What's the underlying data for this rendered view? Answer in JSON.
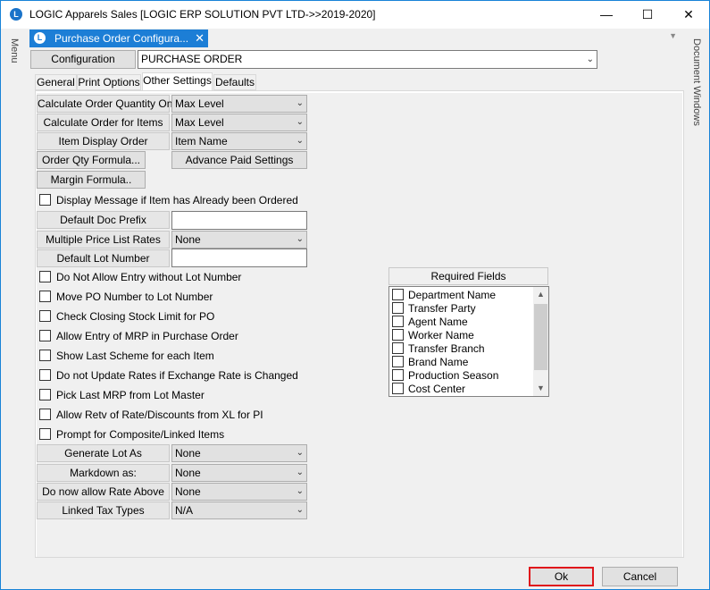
{
  "window": {
    "title": "LOGIC Apparels Sales  [LOGIC ERP SOLUTION PVT LTD->>2019-2020]",
    "icon": "logic-app-icon",
    "controls": {
      "minimize": "—",
      "maximize": "☐",
      "close": "✕"
    }
  },
  "side": {
    "left_label": "Menu",
    "right_label": "Document Windows"
  },
  "doc_tab": {
    "label": "Purchase Order Configura...",
    "close": "✕"
  },
  "configuration": {
    "button_label": "Configuration",
    "value": "PURCHASE ORDER"
  },
  "tabs": [
    "General",
    "Print Options",
    "Other Settings",
    "Defaults"
  ],
  "active_tab": "Other Settings",
  "settings": {
    "calc_qty_label": "Calculate Order Quantity On",
    "calc_qty_value": "Max Level",
    "calc_items_label": "Calculate Order for Items",
    "calc_items_value": "Max Level",
    "item_display_label": "Item Display Order",
    "item_display_value": "Item Name",
    "order_qty_formula": "Order Qty Formula...",
    "advance_paid": "Advance Paid Settings",
    "margin_formula": "Margin Formula..",
    "display_message": "Display Message if Item has Already been Ordered",
    "doc_prefix_label": "Default Doc Prefix",
    "doc_prefix_value": "",
    "price_list_label": "Multiple Price List Rates",
    "price_list_value": "None",
    "lot_number_label": "Default Lot Number",
    "lot_number_value": ""
  },
  "checkboxes": [
    "Do Not Allow Entry without Lot Number",
    "Move PO Number to Lot Number",
    "Check Closing Stock Limit for PO",
    "Allow Entry of MRP in Purchase Order",
    "Show Last Scheme for each Item",
    "Do not Update Rates if Exchange Rate is Changed",
    "Pick Last MRP from Lot Master",
    "Allow Retv of Rate/Discounts from XL for PI",
    "Prompt for Composite/Linked Items"
  ],
  "bottom_settings": [
    {
      "label": "Generate Lot As",
      "value": "None"
    },
    {
      "label": "Markdown as:",
      "value": "None"
    },
    {
      "label": "Do now allow Rate Above",
      "value": "None"
    },
    {
      "label": "Linked Tax Types",
      "value": "N/A"
    }
  ],
  "required_fields": {
    "header": "Required Fields",
    "items": [
      "Department Name",
      "Transfer Party",
      "Agent Name",
      "Worker Name",
      "Transfer Branch",
      "Brand Name",
      "Production Season",
      "Cost Center"
    ]
  },
  "footer": {
    "ok": "Ok",
    "cancel": "Cancel"
  }
}
